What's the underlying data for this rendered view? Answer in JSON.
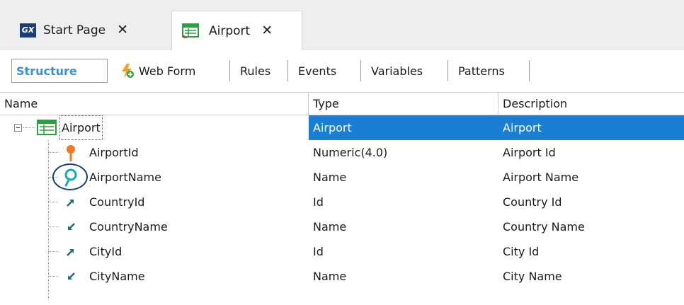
{
  "tabs": [
    {
      "badge": "GX",
      "label": "Start Page",
      "close": "✕"
    },
    {
      "label": "Airport",
      "close": "✕"
    }
  ],
  "editor_tabs": [
    "Structure",
    "Web Form",
    "Rules",
    "Events",
    "Variables",
    "Patterns"
  ],
  "columns": [
    "Name",
    "Type",
    "Description"
  ],
  "rows": [
    {
      "name": "Airport",
      "type": "Airport",
      "description": "Airport",
      "icon": "transaction-icon",
      "selected": true
    },
    {
      "name": "AirportId",
      "type": "Numeric(4.0)",
      "description": "Airport Id",
      "icon": "primary-key-icon"
    },
    {
      "name": "AirportName",
      "type": "Name",
      "description": "Airport Name",
      "icon": "description-attribute-icon"
    },
    {
      "name": "CountryId",
      "type": "Id",
      "description": "Country Id",
      "icon": "foreign-key-icon"
    },
    {
      "name": "CountryName",
      "type": "Name",
      "description": "Country Name",
      "icon": "inferred-attribute-icon"
    },
    {
      "name": "CityId",
      "type": "Id",
      "description": "City Id",
      "icon": "foreign-key-icon"
    },
    {
      "name": "CityName",
      "type": "Name",
      "description": "City Name",
      "icon": "inferred-attribute-icon"
    }
  ],
  "colors": {
    "accent": "#1a7fd4",
    "structure_tab": "#3b8fd6",
    "key_icon": "#f07a22",
    "desc_icon": "#1aa9b0",
    "arrow_icon": "#1a7a85",
    "highlight": "#1c3f73"
  }
}
